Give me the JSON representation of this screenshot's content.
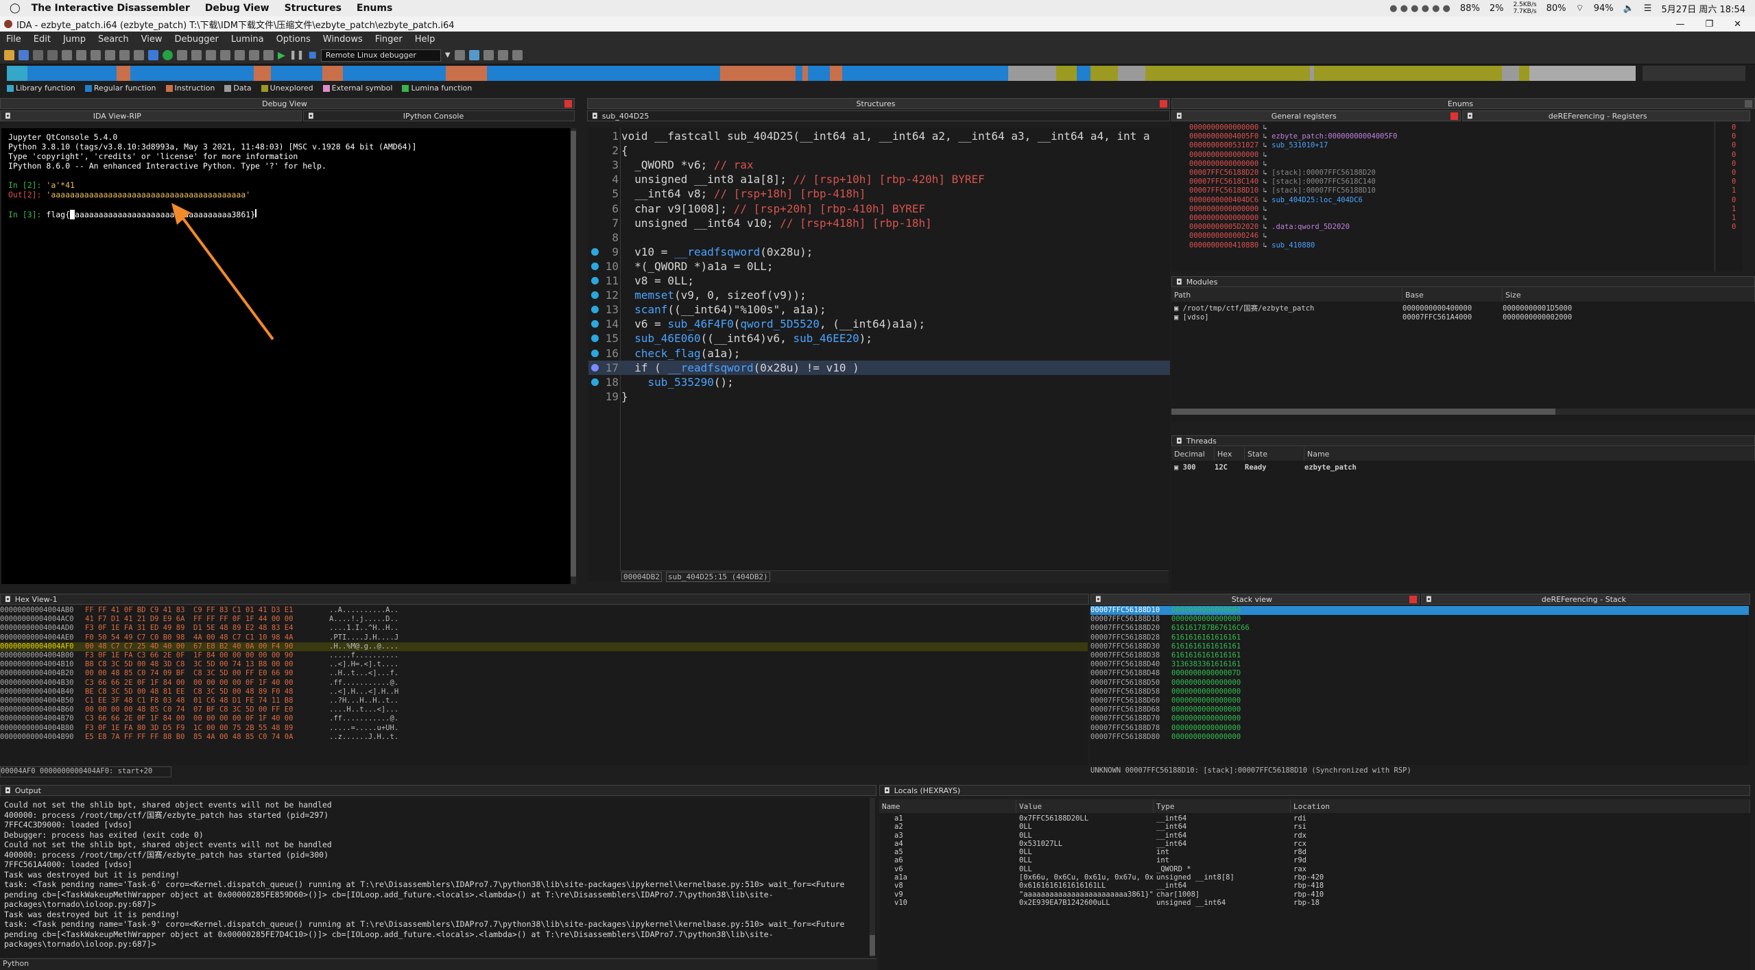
{
  "macbar": {
    "app": "The Interactive Disassembler",
    "menus": [
      "Debug View",
      "Structures",
      "Enums"
    ],
    "netspeed_up": "2.5KB/s",
    "netspeed_down": "7.7KB/s",
    "cpu": "88%",
    "mem": "2%",
    "battery": "80%",
    "wifi_batt": "94%",
    "datetime": "5月27日 周六 18:54"
  },
  "window": {
    "title": "IDA - ezbyte_patch.i64 (ezbyte_patch) T:\\下载\\IDM下载文件\\压缩文件\\ezbyte_patch\\ezbyte_patch.i64"
  },
  "menu": [
    "File",
    "Edit",
    "Jump",
    "Search",
    "View",
    "Debugger",
    "Lumina",
    "Options",
    "Windows",
    "Finger",
    "Help"
  ],
  "toolbar": {
    "debugger": "Remote Linux debugger"
  },
  "legend": [
    {
      "label": "Library function",
      "color": "#35a7c9"
    },
    {
      "label": "Regular function",
      "color": "#1f7fd0"
    },
    {
      "label": "Instruction",
      "color": "#c9704a"
    },
    {
      "label": "Data",
      "color": "#9a9a9a"
    },
    {
      "label": "Unexplored",
      "color": "#9c9a20"
    },
    {
      "label": "External symbol",
      "color": "#e08ac8"
    },
    {
      "label": "Lumina function",
      "color": "#39b54a"
    }
  ],
  "panels": {
    "debug_view": "Debug View",
    "structures": "Structures",
    "enums": "Enums",
    "ida_view": "IDA View-RIP",
    "ipython": "IPython Console",
    "pseudocode": "sub_404D25",
    "general_registers": "General registers",
    "deref_regs": "deREFerencing - Registers",
    "modules": "Modules",
    "threads": "Threads",
    "hex_view": "Hex View-1",
    "stack_view": "Stack view",
    "deref_stack": "deREFerencing - Stack",
    "output": "Output",
    "locals": "Locals (HEXRAYS)"
  },
  "console": {
    "lines": [
      "Jupyter QtConsole 5.4.0",
      "Python 3.8.10 (tags/v3.8.10:3d8993a, May  3 2021, 11:48:03) [MSC v.1928 64 bit (AMD64)]",
      "Type 'copyright', 'credits' or 'license' for more information",
      "IPython 8.6.0 -- An enhanced Interactive Python. Type '?' for help."
    ],
    "in2_prompt": "In [2]:",
    "in2": "'a'*41",
    "out2_prompt": "Out[2]:",
    "out2": "'aaaaaaaaaaaaaaaaaaaaaaaaaaaaaaaaaaaaaaaaa'",
    "in3_prompt": "In [3]:",
    "in3_a": "flag{",
    "in3_b": "aaaaaaaaaaaaaaaaaaaaaaaaaaaaaaaaa3861}"
  },
  "pseudocode": {
    "status_addr": "00004DB2",
    "status_loc": "sub_404D25:15 (404DB2)",
    "lines": [
      {
        "n": "1",
        "t": "void __fastcall sub_404D25(__int64 a1, __int64 a2, __int64 a3, __int64 a4, int a"
      },
      {
        "n": "2",
        "t": "{"
      },
      {
        "n": "3",
        "t": "  _QWORD *v6; // rax"
      },
      {
        "n": "4",
        "t": "  unsigned __int8 a1a[8]; // [rsp+10h] [rbp-420h] BYREF"
      },
      {
        "n": "5",
        "t": "  __int64 v8; // [rsp+18h] [rbp-418h]"
      },
      {
        "n": "6",
        "t": "  char v9[1008]; // [rsp+20h] [rbp-410h] BYREF"
      },
      {
        "n": "7",
        "t": "  unsigned __int64 v10; // [rsp+418h] [rbp-18h]"
      },
      {
        "n": "8",
        "t": ""
      },
      {
        "n": "9",
        "t": "  v10 = __readfsqword(0x28u);"
      },
      {
        "n": "10",
        "t": "  *(_QWORD *)a1a = 0LL;"
      },
      {
        "n": "11",
        "t": "  v8 = 0LL;"
      },
      {
        "n": "12",
        "t": "  memset(v9, 0, sizeof(v9));"
      },
      {
        "n": "13",
        "t": "  scanf((__int64)\"%100s\", a1a);"
      },
      {
        "n": "14",
        "t": "  v6 = sub_46F4F0(qword_5D5520, (__int64)a1a);"
      },
      {
        "n": "15",
        "t": "  sub_46E060((__int64)v6, sub_46EE20);"
      },
      {
        "n": "16",
        "t": "  check_flag(a1a);"
      },
      {
        "n": "17",
        "t": "  if ( __readfsqword(0x28u) != v10 )"
      },
      {
        "n": "18",
        "t": "    sub_535290();"
      },
      {
        "n": "19",
        "t": "}"
      }
    ]
  },
  "registers": [
    {
      "v": "0000000000000000",
      "r": ""
    },
    {
      "v": "00000000004005F0",
      "r": "ezbyte_patch:00000000004005F0"
    },
    {
      "v": "0000000000531027",
      "r": "sub_531010+17"
    },
    {
      "v": "0000000000000000",
      "r": ""
    },
    {
      "v": "0000000000000000",
      "r": ""
    },
    {
      "v": "00007FFC56188D20",
      "r": "[stack]:00007FFC56188D20"
    },
    {
      "v": "00007FFC5618C140",
      "r": "[stack]:00007FFC5618C140"
    },
    {
      "v": "00007FFC56188D10",
      "r": "[stack]:00007FFC56188D10"
    },
    {
      "v": "0000000000404DC6",
      "r": "sub_404D25:loc_404DC6"
    },
    {
      "v": "0000000000000000",
      "r": ""
    },
    {
      "v": "0000000000000000",
      "r": ""
    },
    {
      "v": "00000000005D2020",
      "r": ".data:qword_5D2020"
    },
    {
      "v": "0000000000000246",
      "r": ""
    },
    {
      "v": "0000000000410880",
      "r": "sub_410880"
    }
  ],
  "flags": [
    "0",
    "0",
    "0",
    "0",
    "0",
    "0",
    "0",
    "1",
    "0",
    "1",
    "1",
    "0"
  ],
  "modules": {
    "cols": [
      "Path",
      "Base",
      "Size"
    ],
    "rows": [
      {
        "path": "/root/tmp/ctf/国赛/ezbyte_patch",
        "base": "0000000000400000",
        "size": "00000000001D5000"
      },
      {
        "path": "[vdso]",
        "base": "00007FFC561A4000",
        "size": "0000000000002000"
      }
    ]
  },
  "threads": {
    "cols": [
      "Decimal",
      "Hex",
      "State",
      "Name"
    ],
    "rows": [
      {
        "dec": "300",
        "hex": "12C",
        "state": "Ready",
        "name": "ezbyte_patch"
      }
    ]
  },
  "hex": {
    "rows": [
      {
        "a": "00000000004004AB0",
        "b": "FF FF 41 0F BD C9 41 83  C9 FF 83 C1 01 41 D3 E1",
        "c": "..A..........A.."
      },
      {
        "a": "00000000004004AC0",
        "b": "41 F7 D1 41 21 D9 E9 6A  FF FF FF 0F 1F 44 00 00",
        "c": "A....!.j.....D.."
      },
      {
        "a": "00000000004004AD0",
        "b": "F3 0F 1E FA 31 ED 49 89  D1 5E 48 89 E2 48 83 E4",
        "c": "....1.I..^H..H.."
      },
      {
        "a": "00000000004004AE0",
        "b": "F0 50 54 49 C7 C0 B0 98  4A 00 48 C7 C1 10 98 4A",
        "c": ".PTI....J.H....J"
      },
      {
        "a": "00000000004004AF0",
        "b": "00 48 C7 C7 25 4D 40 00  67 E8 B2 40 0A 00 F4 90",
        "c": ".H..%M@.g..@...."
      },
      {
        "a": "00000000004004B00",
        "b": "F3 0F 1E FA C3 66 2E 0F  1F 84 00 00 00 00 00 90",
        "c": ".....f.........."
      },
      {
        "a": "00000000004004B10",
        "b": "B8 C8 3C 5D 00 48 3D C8  3C 5D 00 74 13 B8 00 00",
        "c": "..<].H=.<].t...."
      },
      {
        "a": "00000000004004B20",
        "b": "00 00 48 85 C0 74 09 BF  C8 3C 5D 00 FF E0 66 90",
        "c": "..H..t...<]...f."
      },
      {
        "a": "00000000004004B30",
        "b": "C3 66 66 2E 0F 1F 84 00  00 00 00 00 0F 1F 40 00",
        "c": ".ff...........@."
      },
      {
        "a": "00000000004004B40",
        "b": "BE C8 3C 5D 00 48 81 EE  C8 3C 5D 00 48 89 F0 48",
        "c": "..<].H...<].H..H"
      },
      {
        "a": "00000000004004B50",
        "b": "C1 EE 3F 48 C1 F8 03 48  01 C6 48 D1 FE 74 11 B8",
        "c": "..?H...H..H..t.."
      },
      {
        "a": "00000000004004B60",
        "b": "00 00 00 00 48 85 C0 74  07 BF C8 3C 5D 00 FF E0",
        "c": "....H..t...<]..."
      },
      {
        "a": "00000000004004B70",
        "b": "C3 66 66 2E 0F 1F 84 00  00 00 00 00 0F 1F 40 00",
        "c": ".ff...........@."
      },
      {
        "a": "00000000004004B80",
        "b": "F3 0F 1E FA 80 3D D5 F9  1C 00 00 75 2B 55 48 89",
        "c": ".....=.....u+UH."
      },
      {
        "a": "00000000004004B90",
        "b": "E5 E8 7A FF FF FF 88 B0  85 4A 00 48 85 C0 74 0A",
        "c": "..z......J.H..t."
      }
    ],
    "status": "00004AF0 0000000000404AF0: start+20"
  },
  "stack": {
    "rows": [
      {
        "a": "00007FFC56188D10",
        "v": "0000000000000000"
      },
      {
        "a": "00007FFC56188D18",
        "v": "0000000000000000"
      },
      {
        "a": "00007FFC56188D20",
        "v": "616161787B67616C66"
      },
      {
        "a": "00007FFC56188D28",
        "v": "6161616161616161"
      },
      {
        "a": "00007FFC56188D30",
        "v": "6161616161616161"
      },
      {
        "a": "00007FFC56188D38",
        "v": "6161616161616161"
      },
      {
        "a": "00007FFC56188D40",
        "v": "3136383361616161"
      },
      {
        "a": "00007FFC56188D48",
        "v": "000000000000007D"
      },
      {
        "a": "00007FFC56188D50",
        "v": "0000000000000000"
      },
      {
        "a": "00007FFC56188D58",
        "v": "0000000000000000"
      },
      {
        "a": "00007FFC56188D60",
        "v": "0000000000000000"
      },
      {
        "a": "00007FFC56188D68",
        "v": "0000000000000000"
      },
      {
        "a": "00007FFC56188D70",
        "v": "0000000000000000"
      },
      {
        "a": "00007FFC56188D78",
        "v": "0000000000000000"
      },
      {
        "a": "00007FFC56188D80",
        "v": "0000000000000000"
      }
    ],
    "status": "UNKNOWN 00007FFC56188D10: [stack]:00007FFC56188D10 (Synchronized with RSP)"
  },
  "output": {
    "lines": [
      "Could not set the shlib bpt, shared object events will not be handled",
      "400000: process /root/tmp/ctf/国赛/ezbyte_patch has started (pid=297)",
      "7FFC4C3D9000: loaded [vdso]",
      "Debugger: process has exited (exit code 0)",
      "Could not set the shlib bpt, shared object events will not be handled",
      "400000: process /root/tmp/ctf/国赛/ezbyte_patch has started (pid=300)",
      "7FFC561A4000: loaded [vdso]",
      "Task was destroyed but it is pending!",
      "task: <Task pending name='Task-6' coro=<Kernel.dispatch_queue() running at T:\\re\\Disassemblers\\IDAPro7.7\\python38\\lib\\site-packages\\ipykernel\\kernelbase.py:510> wait_for=<Future",
      "pending cb=[<TaskWakeupMethWrapper object at 0x00000285FE859D60>()]> cb=[IOLoop.add_future.<locals>.<lambda>() at T:\\re\\Disassemblers\\IDAPro7.7\\python38\\lib\\site-",
      "packages\\tornado\\ioloop.py:687]>",
      "Task was destroyed but it is pending!",
      "task: <Task pending name='Task-9' coro=<Kernel.dispatch_queue() running at T:\\re\\Disassemblers\\IDAPro7.7\\python38\\lib\\site-packages\\ipykernel\\kernelbase.py:510> wait_for=<Future",
      "pending cb=[<TaskWakeupMethWrapper object at 0x00000285FE7D4C10>()]> cb=[IOLoop.add_future.<locals>.<lambda>() at T:\\re\\Disassemblers\\IDAPro7.7\\python38\\lib\\site-",
      "packages\\tornado\\ioloop.py:687]>"
    ],
    "prompt": "Python"
  },
  "locals": {
    "cols": [
      "Name",
      "Value",
      "Type",
      "Location"
    ],
    "rows": [
      {
        "n": "a1",
        "v": "0x7FFC56188D20LL",
        "t": "__int64",
        "l": "rdi"
      },
      {
        "n": "a2",
        "v": "0LL",
        "t": "__int64",
        "l": "rsi"
      },
      {
        "n": "a3",
        "v": "0LL",
        "t": "__int64",
        "l": "rdx"
      },
      {
        "n": "a4",
        "v": "0x531027LL",
        "t": "__int64",
        "l": "rcx"
      },
      {
        "n": "a5",
        "v": "0LL",
        "t": "int",
        "l": "r8d"
      },
      {
        "n": "a6",
        "v": "0LL",
        "t": "int",
        "l": "r9d"
      },
      {
        "n": "v6",
        "v": "0LL",
        "t": "_QWORD *",
        "l": "rax"
      },
      {
        "n": "a1a",
        "v": "[0x66u, 0x6Cu, 0x61u, 0x67u, 0x7Bu…",
        "t": "unsigned __int8[8]",
        "l": "rbp-420"
      },
      {
        "n": "v8",
        "v": "0x6161616161616161LL",
        "t": "__int64",
        "l": "rbp-418"
      },
      {
        "n": "v9",
        "v": "\"aaaaaaaaaaaaaaaaaaaaaaaa3861}\"",
        "t": "char[1008]",
        "l": "rbp-410"
      },
      {
        "n": "v10",
        "v": "0x2E939EA7B1242600uLL",
        "t": "unsigned __int64",
        "l": "rbp-18"
      }
    ]
  }
}
